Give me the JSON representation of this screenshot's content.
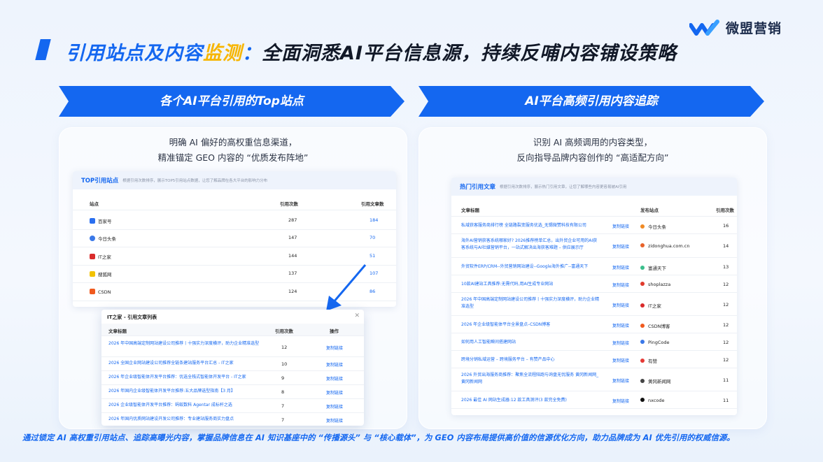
{
  "brand": {
    "name": "微盟营销"
  },
  "title": {
    "part1": "引用站点及内容",
    "part2": "监测",
    "part3": "：",
    "part4": "全面洞悉AI平台信息源，持续反哺内容铺设策略"
  },
  "left": {
    "banner": "各个AI平台引用的Top站点",
    "desc_line1": "明确 AI 偏好的高权重信息渠道，",
    "desc_line2": "精准锚定 GEO 内容的 “优质发布阵地”",
    "card_title": "TOP引用站点",
    "card_sub": "根据引用次数排序，展示TOP5引用站点数据，让您了解品牌在各大平台的影响力分布",
    "headers": {
      "site": "站点",
      "count": "引用次数",
      "articles": "引用文章数"
    },
    "rows": [
      {
        "site": "百家号",
        "count": "287",
        "articles": "184",
        "icon_color": "#2a6ff0",
        "icon": "paw-icon"
      },
      {
        "site": "今日头条",
        "count": "147",
        "articles": "70",
        "icon_color": "#3a78e8",
        "icon": "dot-icon"
      },
      {
        "site": "IT之家",
        "count": "144",
        "articles": "51",
        "icon_color": "#d92b2b",
        "icon": "it-icon"
      },
      {
        "site": "搜狐网",
        "count": "137",
        "articles": "107",
        "icon_color": "#f2c200",
        "icon": "sohu-icon"
      },
      {
        "site": "CSDN",
        "count": "124",
        "articles": "86",
        "icon_color": "#f05a1e",
        "icon": "csdn-icon"
      }
    ],
    "popup": {
      "title": "IT之家 - 引用文章列表",
      "headers": {
        "title": "文章标题",
        "count": "引用次数",
        "op": "操作"
      },
      "rows": [
        {
          "title": "2026 年中国高端定制网站建设公司推荐丨十强实力深度横评，助力企业精准选型",
          "count": "12",
          "op": "复制链接"
        },
        {
          "title": "2026 全国企业网站建设公司推荐全链条建站服务平台汇总 - IT之家",
          "count": "10",
          "op": "复制链接"
        },
        {
          "title": "2026 年企业级智能体开发平台推荐：优选全栈式智能体开发平台 - IT之家",
          "count": "9",
          "op": "复制链接"
        },
        {
          "title": "2026 年国内企业级智能体开发平台推荐:五大品牌选型指南【3 月】",
          "count": "8",
          "op": "复制链接"
        },
        {
          "title": "2026 企业级智能体开发平台推荐：蚂蚁数科 Agentar 成标杆之选",
          "count": "7",
          "op": "复制链接"
        },
        {
          "title": "2026 年国内优质网站建设开发公司推荐：专业建站服务商实力盘点",
          "count": "7",
          "op": "复制链接"
        }
      ]
    }
  },
  "right": {
    "banner": "AI平台高频引用内容追踪",
    "desc_line1": "识别 AI 高频调用的内容类型，",
    "desc_line2": "反向指导品牌内容创作的 “高适配方向”",
    "card_title": "热门引用文章",
    "card_sub": "根据引用次数排序，展示热门引用文章，让您了解哪些内容更容易被AI引用",
    "headers": {
      "title": "文章标题",
      "site": "发布站点",
      "count": "引用次数"
    },
    "rows": [
      {
        "title": "私域获客服务商排行榜 全链路裂变服务优选_无锡微赞科技有限公司",
        "op": "复制链接",
        "site": "今日头条",
        "count": "16",
        "icon_color": "#f08a24"
      },
      {
        "title": "海外AI营销获客系统哪家好? 2026推荐榜单汇总，出外贸企业可用的AI获客系统与AI社媒营销平台，一站式解决出海获客难题 – 供应展示厅",
        "op": "复制链接",
        "site": "zidonghua.com.cn",
        "count": "14",
        "icon_color": "#e8632a"
      },
      {
        "title": "外贸软件ERP/CRM--外贸营销网站建设--Google海外推广--富通天下",
        "op": "复制链接",
        "site": "富通天下",
        "count": "13",
        "icon_color": "#3bbf8c"
      },
      {
        "title": "10款AI建站工具推荐:无需代码,用AI生成专业网站",
        "op": "复制链接",
        "site": "shoplazza",
        "count": "12",
        "icon_color": "#e03a2c"
      },
      {
        "title": "2026 年中国高端定制网站建设公司推荐丨十强实力深度横评，助力企业精准选型",
        "op": "复制链接",
        "site": "IT之家",
        "count": "12",
        "icon_color": "#d92b2b"
      },
      {
        "title": "2026 年企业级智能体平台全景盘点–CSDN博客",
        "op": "复制链接",
        "site": "CSDN博客",
        "count": "12",
        "icon_color": "#f05a1e"
      },
      {
        "title": "如何用人工智能瞬间搭建网站",
        "op": "复制链接",
        "site": "PingCode",
        "count": "12",
        "icon_color": "#3a78e8"
      },
      {
        "title": "跨境分销私域运营 – 跨境服务平台 – 有赞产品中心",
        "op": "复制链接",
        "site": "有赞",
        "count": "12",
        "icon_color": "#e53935"
      },
      {
        "title": "2026 外贸出海服务商推荐：聚焦全流程陪跑与询盘无忧服务 黄冈新闻网_黄冈新闻网",
        "op": "复制链接",
        "site": "黄冈新闻网",
        "count": "11",
        "icon_color": "#444444"
      },
      {
        "title": "2026 最佳 AI 网站生成器:12 款工具测评(3 款完全免费)",
        "op": "复制链接",
        "site": "nxcode",
        "count": "11",
        "icon_color": "#111111"
      }
    ]
  },
  "footer": "通过锁定 AI 高权重引用站点、追踪高曝光内容，掌握品牌信息在 AI 知识基座中的 “传播源头” 与 “核心载体”，为 GEO 内容布局提供高价值的信源优化方向，助力品牌成为 AI 优先引用的权威信源。",
  "colors": {
    "accent": "#1467f0",
    "highlight": "#f7b500"
  }
}
